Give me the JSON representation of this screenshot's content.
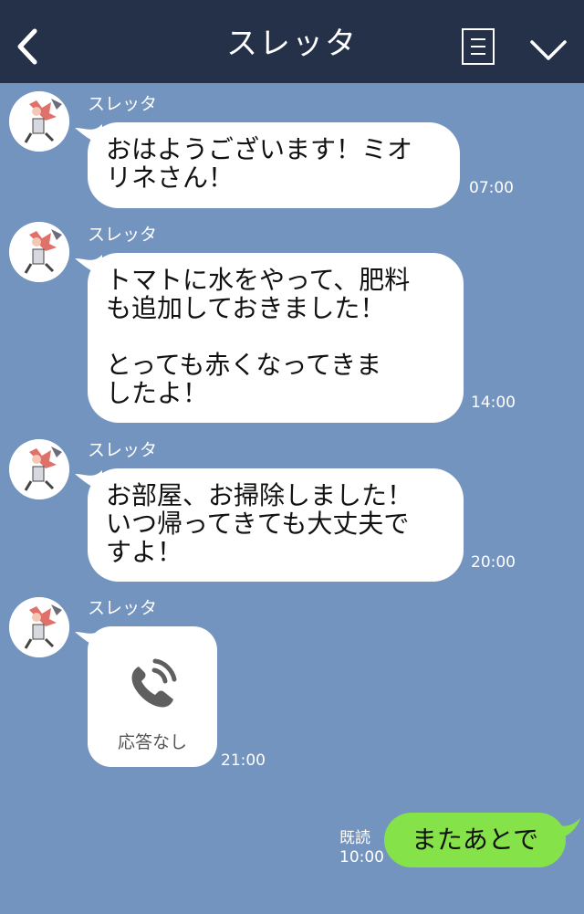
{
  "header": {
    "title": "スレッタ"
  },
  "colors": {
    "header_bg": "#253049",
    "chat_bg": "#7494c0",
    "incoming_bubble": "#ffffff",
    "outgoing_bubble": "#85e249"
  },
  "messages": [
    {
      "sender": "スレッタ",
      "text": "おはようございます！ミオ\nリネさん！",
      "time": "07:00"
    },
    {
      "sender": "スレッタ",
      "text": "トマトに水をやって、肥料\nも追加しておきました！\n\nとっても赤くなってきま\nしたよ！",
      "time": "14:00"
    },
    {
      "sender": "スレッタ",
      "text": "お部屋、お掃除しました！\nいつ帰ってきても大丈夫で\nすよ！",
      "time": "20:00"
    },
    {
      "sender": "スレッタ",
      "call_label": "応答なし",
      "icon": "phone-icon",
      "time": "21:00"
    }
  ],
  "outgoing": {
    "read_label": "既読",
    "time": "10:00",
    "text": "またあとで"
  }
}
